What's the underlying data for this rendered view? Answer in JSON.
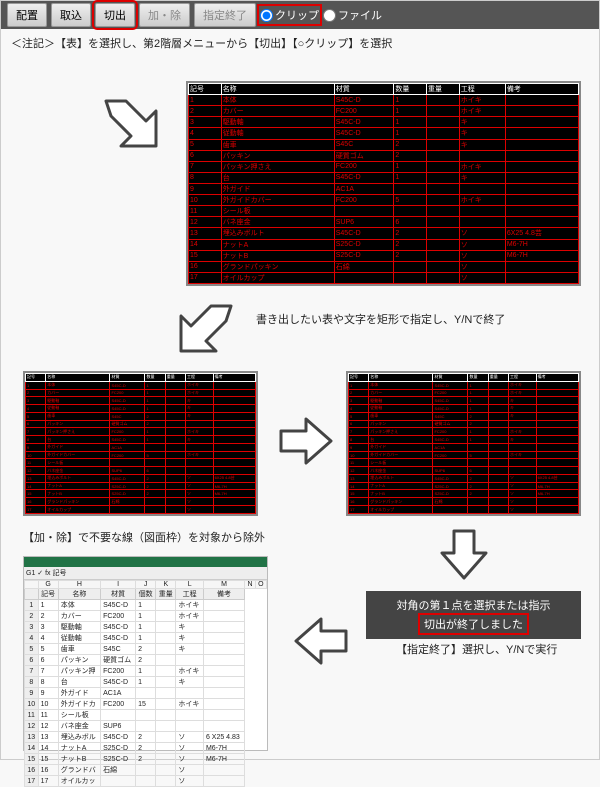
{
  "toolbar": {
    "btns": [
      "配置",
      "取込",
      "切出",
      "加・除",
      "指定終了"
    ],
    "radio1": "クリップ",
    "radio2": "ファイル"
  },
  "caption1": "＜注記＞【表】を選択し、第2階層メニューから【切出】【○クリップ】を選択",
  "step2": "書き出したい表や文字を矩形で指定し、Y/Nで終了",
  "step3": "【加・除】で不要な線（図面枠）を対象から除外",
  "msg1": "対角の第１点を選択または指示",
  "msg2": "切出が終了しました",
  "step4": "【指定終了】選択し、Y/Nで実行",
  "cad_headers": [
    "記号",
    "名称",
    "材質",
    "数量",
    "重量",
    "工程",
    "備考"
  ],
  "cad_rows": [
    [
      "1",
      "本体",
      "S45C-D",
      "1",
      "",
      "ホイキ",
      ""
    ],
    [
      "2",
      "カバー",
      "FC200",
      "1",
      "",
      "ホイキ",
      ""
    ],
    [
      "3",
      "駆動軸",
      "S45C-D",
      "1",
      "",
      "キ",
      ""
    ],
    [
      "4",
      "従動軸",
      "S45C-D",
      "1",
      "",
      "キ",
      ""
    ],
    [
      "5",
      "歯車",
      "S45C",
      "2",
      "",
      "キ",
      ""
    ],
    [
      "6",
      "パッキン",
      "硬質ゴム",
      "2",
      "",
      "",
      ""
    ],
    [
      "7",
      "パッキン押さえ",
      "FC200",
      "1",
      "",
      "ホイキ",
      ""
    ],
    [
      "8",
      "台",
      "S45C-D",
      "1",
      "",
      "キ",
      ""
    ],
    [
      "9",
      "外ガイド",
      "AC1A",
      "",
      "",
      "",
      ""
    ],
    [
      "10",
      "外ガイドカバー",
      "FC200",
      "5",
      "",
      "ホイキ",
      ""
    ],
    [
      "11",
      "シール板",
      "",
      "",
      "",
      "",
      ""
    ],
    [
      "12",
      "バネ座金",
      "SUP6",
      "6",
      "",
      "",
      ""
    ],
    [
      "13",
      "埋込みボルト",
      "S45C-D",
      "2",
      "",
      "ソ",
      "6X25 4.8芸"
    ],
    [
      "14",
      "ナットA",
      "S25C-D",
      "2",
      "",
      "ソ",
      "M6-7H"
    ],
    [
      "15",
      "ナットB",
      "S25C-D",
      "2",
      "",
      "ソ",
      "M6-7H"
    ],
    [
      "16",
      "グランドパッキン",
      "石綿",
      "",
      "",
      "ソ",
      ""
    ],
    [
      "17",
      "オイルカップ",
      "",
      "",
      "",
      "ソ",
      ""
    ]
  ],
  "excel": {
    "fx_cell": "G1",
    "fx_val": "記号",
    "cols": [
      "",
      "G",
      "H",
      "I",
      "J",
      "K",
      "L",
      "M",
      "N",
      "O"
    ],
    "headers": [
      "",
      "記号",
      "名称",
      "材質",
      "個数",
      "重量",
      "工程",
      "備考"
    ],
    "rows": [
      [
        "1",
        "1",
        "本体",
        "S45C-D",
        "1",
        "",
        "ホイキ",
        ""
      ],
      [
        "2",
        "2",
        "カバー",
        "FC200",
        "1",
        "",
        "ホイキ",
        ""
      ],
      [
        "3",
        "3",
        "駆動軸",
        "S45C-D",
        "1",
        "",
        "キ",
        ""
      ],
      [
        "4",
        "4",
        "従動軸",
        "S45C-D",
        "1",
        "",
        "キ",
        ""
      ],
      [
        "5",
        "5",
        "歯車",
        "S45C",
        "2",
        "",
        "キ",
        ""
      ],
      [
        "6",
        "6",
        "パッキン",
        "硬質ゴム",
        "2",
        "",
        "",
        ""
      ],
      [
        "7",
        "7",
        "パッキン押",
        "FC200",
        "1",
        "",
        "ホイキ",
        ""
      ],
      [
        "8",
        "8",
        "台",
        "S45C-D",
        "1",
        "",
        "キ",
        ""
      ],
      [
        "9",
        "9",
        "外ガイド",
        "AC1A",
        "",
        "",
        "",
        ""
      ],
      [
        "10",
        "10",
        "外ガイドカ",
        "FC200",
        "15",
        "",
        "ホイキ",
        ""
      ],
      [
        "11",
        "11",
        "シール板",
        "",
        "",
        "",
        "",
        ""
      ],
      [
        "12",
        "12",
        "バネ座金",
        "SUP6",
        "",
        "",
        "",
        ""
      ],
      [
        "13",
        "13",
        "埋込みボル",
        "S45C-D",
        "2",
        "",
        "ソ",
        "6 X25 4.83"
      ],
      [
        "14",
        "14",
        "ナットA",
        "S25C-D",
        "2",
        "",
        "ソ",
        "M6-7H"
      ],
      [
        "15",
        "15",
        "ナットB",
        "S25C-D",
        "2",
        "",
        "ソ",
        "M6-7H"
      ],
      [
        "16",
        "16",
        "グランドバ",
        "石綿",
        "",
        "",
        "ソ",
        ""
      ],
      [
        "17",
        "17",
        "オイルカッ",
        "",
        "",
        "",
        "ソ",
        ""
      ]
    ]
  }
}
